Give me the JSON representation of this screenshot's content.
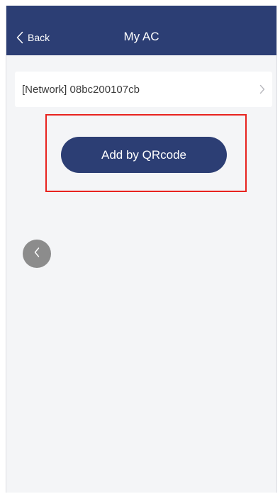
{
  "header": {
    "back_label": "Back",
    "title": "My AC",
    "back_icon": "chevron-left-icon"
  },
  "device_list": {
    "items": [
      {
        "label": "[Network] 08bc200107cb",
        "icon": "chevron-right-icon"
      }
    ]
  },
  "actions": {
    "add_qr_label": "Add by QRcode"
  },
  "floating": {
    "icon": "chevron-left-icon"
  },
  "colors": {
    "nav_bg": "#2c3e74",
    "button_bg": "#2c3e74",
    "highlight": "#e8231f",
    "background": "#f4f5f7"
  }
}
